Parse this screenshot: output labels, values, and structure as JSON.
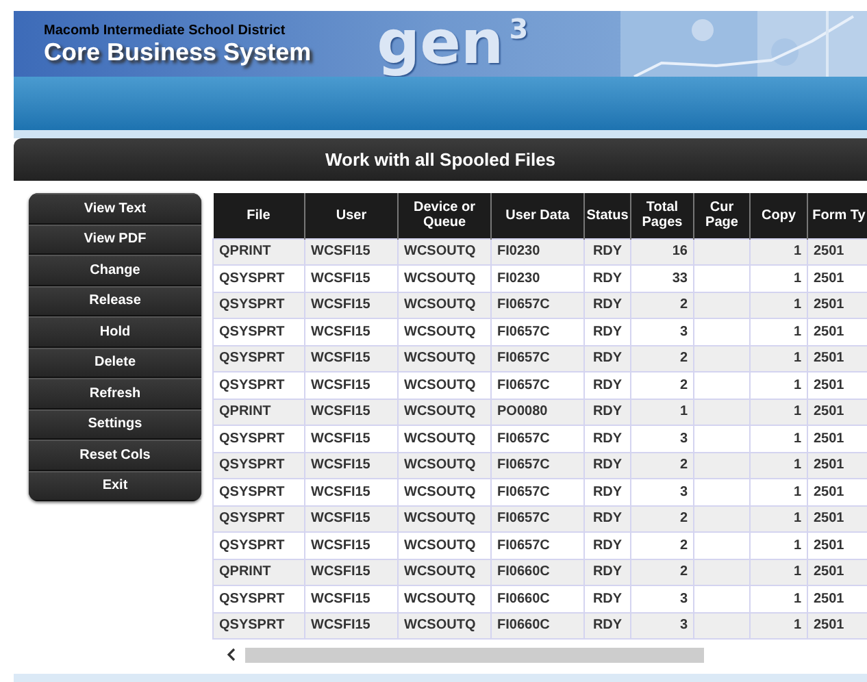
{
  "banner": {
    "subtitle": "Macomb Intermediate School District",
    "title": "Core Business System",
    "logo_text": "gen",
    "logo_sup": "3"
  },
  "page_title": "Work with all Spooled Files",
  "sidebar": {
    "buttons": [
      "View Text",
      "View PDF",
      "Change",
      "Release",
      "Hold",
      "Delete",
      "Refresh",
      "Settings",
      "Reset Cols",
      "Exit"
    ]
  },
  "table": {
    "columns": [
      "File",
      "User",
      "Device or Queue",
      "User Data",
      "Status",
      "Total Pages",
      "Cur Page",
      "Copy",
      "Form Ty"
    ],
    "rows": [
      {
        "file": "QPRINT",
        "user": "WCSFI15",
        "device": "WCSOUTQ",
        "user_data": "FI0230",
        "status": "RDY",
        "total_pages": "16",
        "copy": "1",
        "form_type": "2501"
      },
      {
        "file": "QSYSPRT",
        "user": "WCSFI15",
        "device": "WCSOUTQ",
        "user_data": "FI0230",
        "status": "RDY",
        "total_pages": "33",
        "copy": "1",
        "form_type": "2501"
      },
      {
        "file": "QSYSPRT",
        "user": "WCSFI15",
        "device": "WCSOUTQ",
        "user_data": "FI0657C",
        "status": "RDY",
        "total_pages": "2",
        "copy": "1",
        "form_type": "2501"
      },
      {
        "file": "QSYSPRT",
        "user": "WCSFI15",
        "device": "WCSOUTQ",
        "user_data": "FI0657C",
        "status": "RDY",
        "total_pages": "3",
        "copy": "1",
        "form_type": "2501"
      },
      {
        "file": "QSYSPRT",
        "user": "WCSFI15",
        "device": "WCSOUTQ",
        "user_data": "FI0657C",
        "status": "RDY",
        "total_pages": "2",
        "copy": "1",
        "form_type": "2501"
      },
      {
        "file": "QSYSPRT",
        "user": "WCSFI15",
        "device": "WCSOUTQ",
        "user_data": "FI0657C",
        "status": "RDY",
        "total_pages": "2",
        "copy": "1",
        "form_type": "2501"
      },
      {
        "file": "QPRINT",
        "user": "WCSFI15",
        "device": "WCSOUTQ",
        "user_data": "PO0080",
        "status": "RDY",
        "total_pages": "1",
        "copy": "1",
        "form_type": "2501"
      },
      {
        "file": "QSYSPRT",
        "user": "WCSFI15",
        "device": "WCSOUTQ",
        "user_data": "FI0657C",
        "status": "RDY",
        "total_pages": "3",
        "copy": "1",
        "form_type": "2501"
      },
      {
        "file": "QSYSPRT",
        "user": "WCSFI15",
        "device": "WCSOUTQ",
        "user_data": "FI0657C",
        "status": "RDY",
        "total_pages": "2",
        "copy": "1",
        "form_type": "2501"
      },
      {
        "file": "QSYSPRT",
        "user": "WCSFI15",
        "device": "WCSOUTQ",
        "user_data": "FI0657C",
        "status": "RDY",
        "total_pages": "3",
        "copy": "1",
        "form_type": "2501"
      },
      {
        "file": "QSYSPRT",
        "user": "WCSFI15",
        "device": "WCSOUTQ",
        "user_data": "FI0657C",
        "status": "RDY",
        "total_pages": "2",
        "copy": "1",
        "form_type": "2501"
      },
      {
        "file": "QSYSPRT",
        "user": "WCSFI15",
        "device": "WCSOUTQ",
        "user_data": "FI0657C",
        "status": "RDY",
        "total_pages": "2",
        "copy": "1",
        "form_type": "2501"
      },
      {
        "file": "QPRINT",
        "user": "WCSFI15",
        "device": "WCSOUTQ",
        "user_data": "FI0660C",
        "status": "RDY",
        "total_pages": "2",
        "copy": "1",
        "form_type": "2501"
      },
      {
        "file": "QSYSPRT",
        "user": "WCSFI15",
        "device": "WCSOUTQ",
        "user_data": "FI0660C",
        "status": "RDY",
        "total_pages": "3",
        "copy": "1",
        "form_type": "2501"
      },
      {
        "file": "QSYSPRT",
        "user": "WCSFI15",
        "device": "WCSOUTQ",
        "user_data": "FI0660C",
        "status": "RDY",
        "total_pages": "3",
        "copy": "1",
        "form_type": "2501"
      }
    ]
  }
}
